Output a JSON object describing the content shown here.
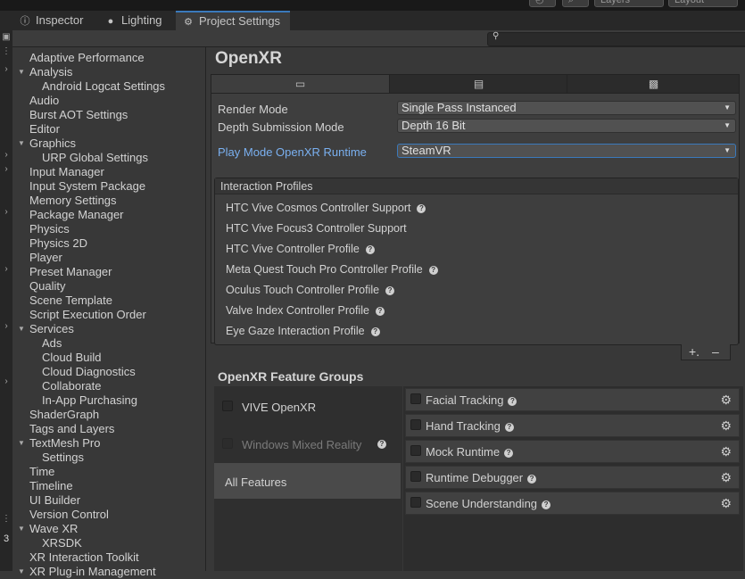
{
  "toolbar": {
    "layers_label": "Layers",
    "layout_label": "Layout"
  },
  "tabs": [
    {
      "label": "Inspector",
      "icon": "info-icon"
    },
    {
      "label": "Lighting",
      "icon": "lightbulb-icon"
    },
    {
      "label": "Project Settings",
      "icon": "gear-icon"
    }
  ],
  "left_strip": {
    "counter": "3"
  },
  "nav": [
    {
      "label": "Adaptive Performance"
    },
    {
      "label": "Analysis",
      "expanded": true
    },
    {
      "label": "Android Logcat Settings",
      "child": true
    },
    {
      "label": "Audio"
    },
    {
      "label": "Burst AOT Settings"
    },
    {
      "label": "Editor"
    },
    {
      "label": "Graphics",
      "expanded": true
    },
    {
      "label": "URP Global Settings",
      "child": true
    },
    {
      "label": "Input Manager"
    },
    {
      "label": "Input System Package"
    },
    {
      "label": "Memory Settings"
    },
    {
      "label": "Package Manager"
    },
    {
      "label": "Physics"
    },
    {
      "label": "Physics 2D"
    },
    {
      "label": "Player"
    },
    {
      "label": "Preset Manager"
    },
    {
      "label": "Quality"
    },
    {
      "label": "Scene Template"
    },
    {
      "label": "Script Execution Order"
    },
    {
      "label": "Services",
      "expanded": true
    },
    {
      "label": "Ads",
      "child": true
    },
    {
      "label": "Cloud Build",
      "child": true
    },
    {
      "label": "Cloud Diagnostics",
      "child": true
    },
    {
      "label": "Collaborate",
      "child": true
    },
    {
      "label": "In-App Purchasing",
      "child": true
    },
    {
      "label": "ShaderGraph"
    },
    {
      "label": "Tags and Layers"
    },
    {
      "label": "TextMesh Pro",
      "expanded": true
    },
    {
      "label": "Settings",
      "child": true
    },
    {
      "label": "Time"
    },
    {
      "label": "Timeline"
    },
    {
      "label": "UI Builder"
    },
    {
      "label": "Version Control"
    },
    {
      "label": "Wave XR",
      "expanded": true
    },
    {
      "label": "XRSDK",
      "child": true
    },
    {
      "label": "XR Interaction Toolkit"
    },
    {
      "label": "XR Plug-in Management",
      "expanded": true
    }
  ],
  "main": {
    "title": "OpenXR",
    "platform_tabs": [
      {
        "icon": "monitor-icon",
        "glyph": "🖵"
      },
      {
        "icon": "server-icon",
        "glyph": "☷"
      },
      {
        "icon": "android-icon",
        "glyph": "☖"
      }
    ],
    "settings": [
      {
        "label": "Render Mode",
        "value": "Single Pass Instanced"
      },
      {
        "label": "Depth Submission Mode",
        "value": "Depth 16 Bit"
      },
      {
        "label": "Play Mode OpenXR Runtime",
        "value": "SteamVR"
      }
    ],
    "interaction_profiles": {
      "header": "Interaction Profiles",
      "items": [
        {
          "label": "HTC Vive Cosmos Controller Support",
          "help": true
        },
        {
          "label": "HTC Vive Focus3 Controller Support",
          "help": false
        },
        {
          "label": "HTC Vive Controller Profile",
          "help": true
        },
        {
          "label": "Meta Quest Touch Pro Controller Profile",
          "help": true
        },
        {
          "label": "Oculus Touch Controller Profile",
          "help": true
        },
        {
          "label": "Valve Index Controller Profile",
          "help": true
        },
        {
          "label": "Eye Gaze Interaction Profile",
          "help": true
        }
      ],
      "add_label": "+.",
      "remove_label": "–"
    },
    "feature_groups": {
      "title": "OpenXR Feature Groups",
      "groups": [
        {
          "label": "VIVE OpenXR",
          "checked": false,
          "disabled": false
        },
        {
          "label": "Windows Mixed Reality",
          "checked": false,
          "disabled": true
        },
        {
          "label": "All Features",
          "selected": true
        }
      ],
      "features": [
        {
          "label": "Facial Tracking",
          "checked": false
        },
        {
          "label": "Hand Tracking",
          "checked": false
        },
        {
          "label": "Mock Runtime",
          "checked": false
        },
        {
          "label": "Runtime Debugger",
          "checked": false
        },
        {
          "label": "Scene Understanding",
          "checked": false
        }
      ]
    }
  }
}
